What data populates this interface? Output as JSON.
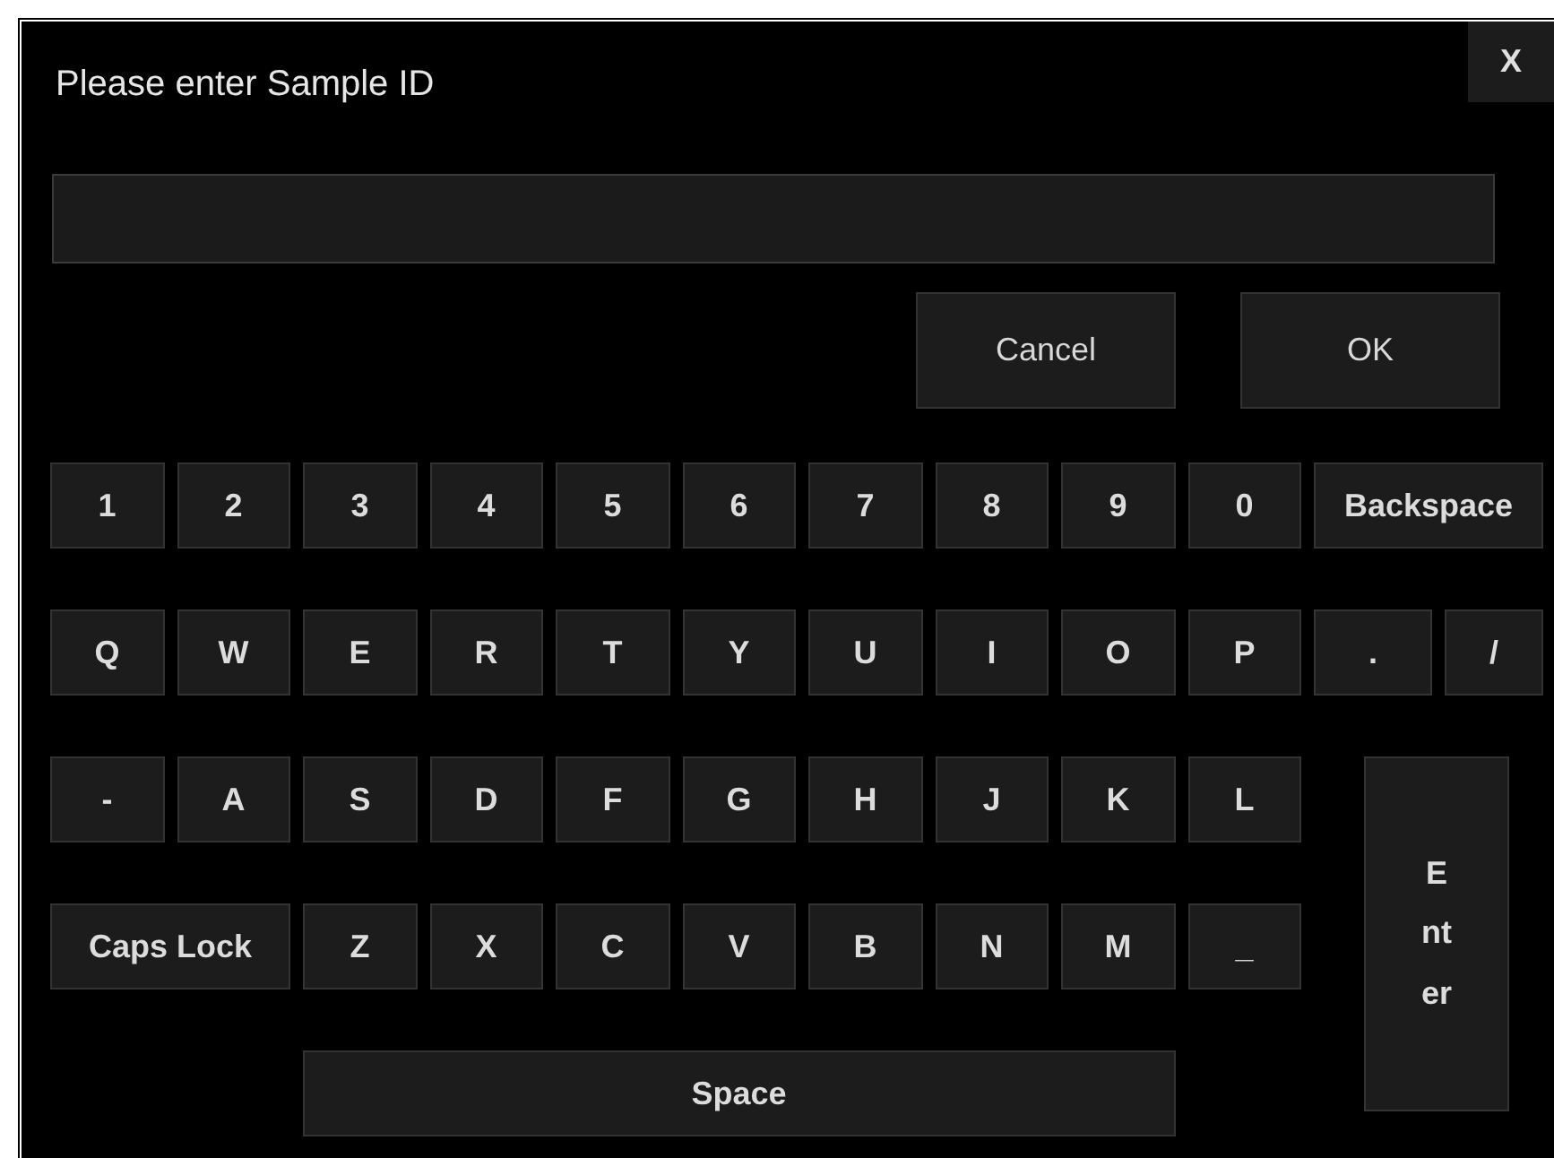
{
  "dialog": {
    "title": "Please enter Sample ID",
    "close": "X"
  },
  "buttons": [
    "Cancel",
    "OK"
  ],
  "keys": [
    {
      "label": "1",
      "kind": "char"
    },
    {
      "label": "2",
      "kind": "char"
    },
    {
      "label": "3",
      "kind": "char"
    },
    {
      "label": "4",
      "kind": "char"
    },
    {
      "label": "5",
      "kind": "char"
    },
    {
      "label": "6",
      "kind": "char"
    },
    {
      "label": "7",
      "kind": "char"
    },
    {
      "label": "8",
      "kind": "char"
    },
    {
      "label": "9",
      "kind": "char"
    },
    {
      "label": "0",
      "kind": "char"
    },
    {
      "label": "Backspace",
      "kind": "backspace"
    },
    {
      "label": "Q",
      "kind": "char"
    },
    {
      "label": "W",
      "kind": "char"
    },
    {
      "label": "E",
      "kind": "char"
    },
    {
      "label": "R",
      "kind": "char"
    },
    {
      "label": "T",
      "kind": "char"
    },
    {
      "label": "Y",
      "kind": "char"
    },
    {
      "label": "U",
      "kind": "char"
    },
    {
      "label": "I",
      "kind": "char"
    },
    {
      "label": "O",
      "kind": "char"
    },
    {
      "label": "P",
      "kind": "char"
    },
    {
      "label": ".",
      "kind": "period"
    },
    {
      "label": "/",
      "kind": "slash"
    },
    {
      "label": "-",
      "kind": "char"
    },
    {
      "label": "A",
      "kind": "char"
    },
    {
      "label": "S",
      "kind": "char"
    },
    {
      "label": "D",
      "kind": "char"
    },
    {
      "label": "F",
      "kind": "char"
    },
    {
      "label": "G",
      "kind": "char"
    },
    {
      "label": "H",
      "kind": "char"
    },
    {
      "label": "J",
      "kind": "char"
    },
    {
      "label": "K",
      "kind": "char"
    },
    {
      "label": "L",
      "kind": "char"
    },
    {
      "label": "Enter",
      "kind": "enter"
    },
    {
      "label": "Caps Lock",
      "kind": "caps"
    },
    {
      "label": "Z",
      "kind": "char"
    },
    {
      "label": "X",
      "kind": "char"
    },
    {
      "label": "C",
      "kind": "char"
    },
    {
      "label": "V",
      "kind": "char"
    },
    {
      "label": "B",
      "kind": "char"
    },
    {
      "label": "N",
      "kind": "char"
    },
    {
      "label": "M",
      "kind": "char"
    },
    {
      "label": "_",
      "kind": "char"
    },
    {
      "label": "Space",
      "kind": "space"
    }
  ]
}
